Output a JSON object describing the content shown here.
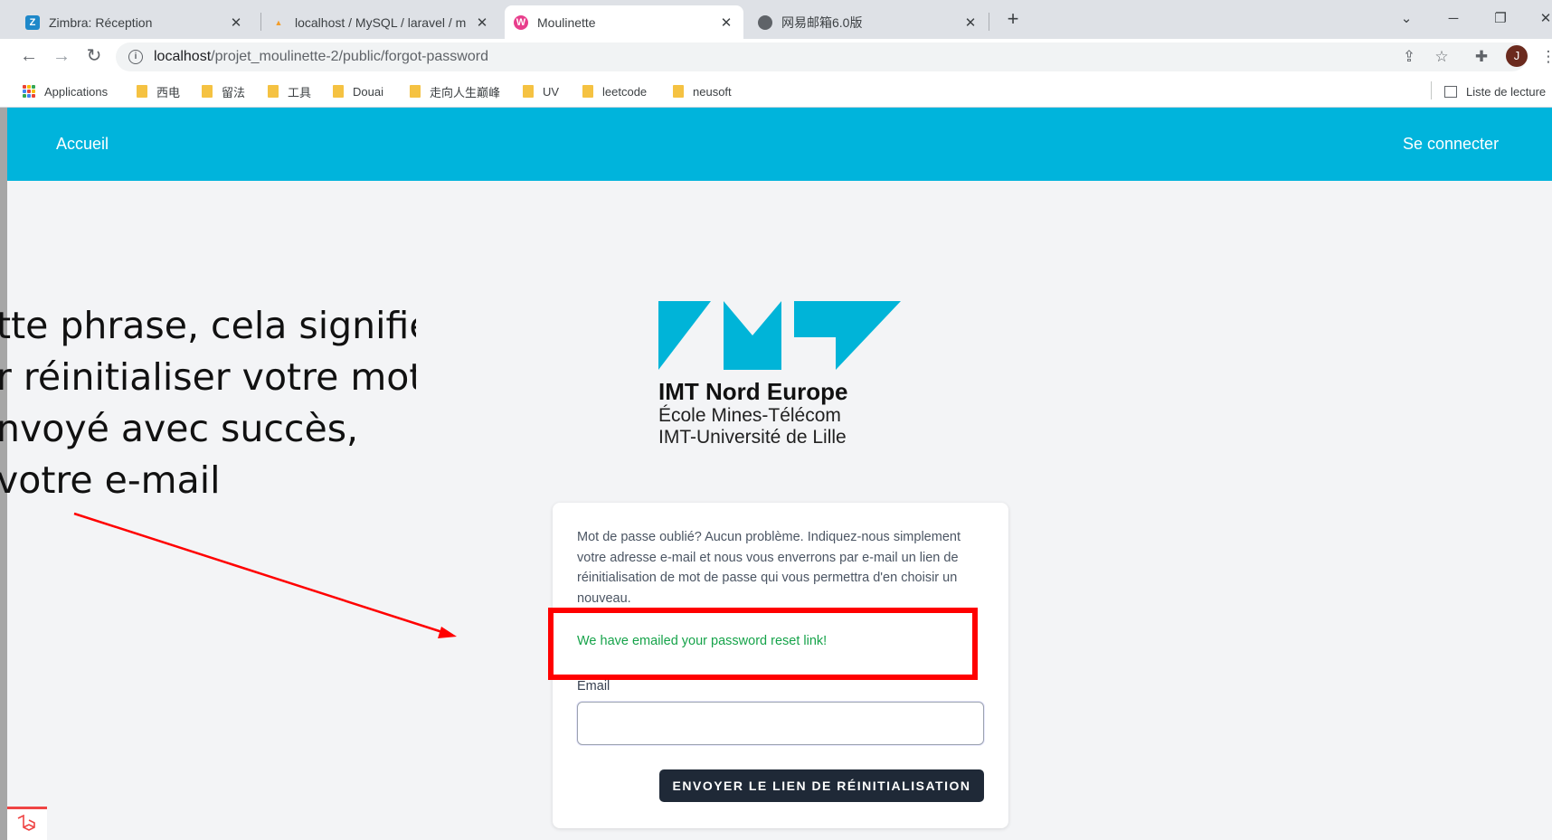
{
  "browser": {
    "tabs": [
      {
        "title": "Zimbra: Réception",
        "favicon_letter": "Z",
        "favicon_color": "#1e88c9"
      },
      {
        "title": "localhost / MySQL / laravel / m",
        "favicon_letter": "pma",
        "favicon_color": "#f29d2b"
      },
      {
        "title": "Moulinette",
        "favicon_letter": "W",
        "favicon_color": "#e83e8c"
      },
      {
        "title": "网易邮箱6.0版",
        "favicon_letter": "",
        "favicon_color": "#5f6368"
      }
    ],
    "url_host": "localhost",
    "url_path": "/projet_moulinette-2/public/forgot-password",
    "profile_initial": "J",
    "bookmarks": [
      "Applications",
      "西电",
      "留法",
      "工具",
      "Douai",
      "走向人生巅峰",
      "UV",
      "leetcode",
      "neusoft"
    ],
    "reading_list": "Liste de lecture"
  },
  "site": {
    "nav_home": "Accueil",
    "nav_login": "Se connecter",
    "logo_line1": "IMT Nord Europe",
    "logo_line2": "École Mines-Télécom",
    "logo_line3": "IMT-Université de Lille",
    "brand_color": "#00b4dc"
  },
  "form": {
    "description": "Mot de passe oublié? Aucun problème. Indiquez-nous simplement votre adresse e-mail et nous vous enverrons par e-mail un lien de réinitialisation de mot de passe qui vous permettra d'en choisir un nouveau.",
    "status": "We have emailed your password reset link!",
    "email_label": "Email",
    "email_value": "",
    "submit_label": "ENVOYER LE LIEN DE RÉINITIALISATION"
  },
  "annotation": {
    "lines": [
      "tte phrase, cela signifie",
      "r réinitialiser votre mot",
      "nvoyé avec succès,",
      "votre e-mail"
    ],
    "color": "#ff0000"
  }
}
